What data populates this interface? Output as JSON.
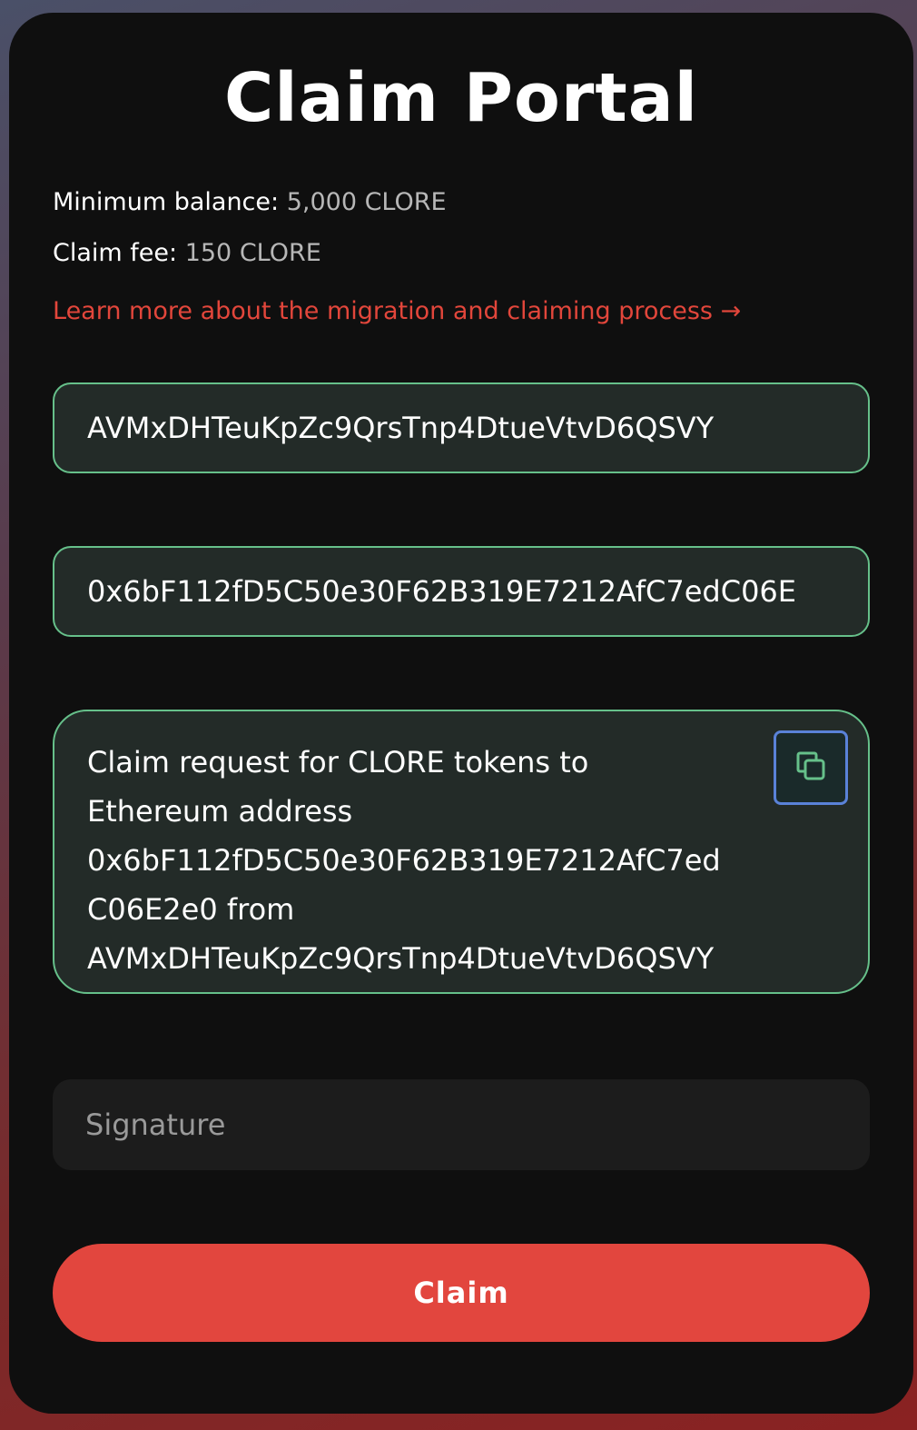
{
  "portal": {
    "title": "Claim Portal",
    "minimum_balance_label": "Minimum balance:",
    "minimum_balance_value": "5,000 CLORE",
    "claim_fee_label": "Claim fee:",
    "claim_fee_value": "150 CLORE",
    "learn_more_link": "Learn more about the migration and claiming process →"
  },
  "form": {
    "clore_address": "AVMxDHTeuKpZc9QrsTnp4DtueVtvD6QSVY",
    "eth_address": "0x6bF112fD5C50e30F62B319E7212AfC7edC06E",
    "message_lines": [
      "Claim request for CLORE tokens to",
      "Ethereum address",
      "0x6bF112fD5C50e30F62B319E7212AfC7ed",
      "C06E2e0 from",
      "AVMxDHTeuKpZc9QrsTnp4DtueVtvD6QSVY"
    ],
    "copy_icon": "copy-icon",
    "signature_placeholder": "Signature",
    "signature_value": "",
    "claim_button": "Claim"
  },
  "colors": {
    "card_background": "#0f0f0f",
    "accent_red": "#e2463e",
    "field_border_green": "#66c08a",
    "field_background": "#232b28",
    "muted_value": "#b7b7b7"
  }
}
